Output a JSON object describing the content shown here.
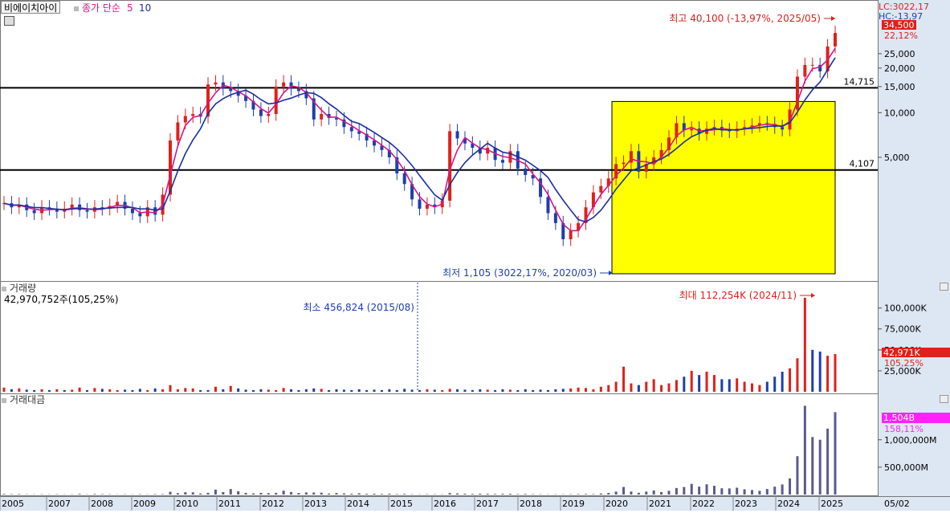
{
  "chart_data": [
    {
      "type": "candlestick",
      "title": "비에이치아이",
      "legend": [
        {
          "label": "종가 단순",
          "color": "#d4168a"
        },
        {
          "label": "5",
          "color": "#d4168a"
        },
        {
          "label": "10",
          "color": "#1a2ea0"
        }
      ],
      "y_scale": "log",
      "y_ticks": [
        5000,
        10000,
        15000,
        20000,
        25000
      ],
      "y_tick_labels": [
        "5,000",
        "10,000",
        "15,000",
        "20,000",
        "25,000"
      ],
      "hlines": [
        {
          "value": 14715,
          "label": "14,715"
        },
        {
          "value": 4107,
          "label": "4,107"
        }
      ],
      "highlight_box": {
        "x_start": "2020-01",
        "x_end": "2025-03",
        "y_low": 1105,
        "y_high": 11900,
        "color": "#ffff00"
      },
      "annotations": {
        "max": {
          "text": "최고 40,100 (-13,97%, 2025/05)",
          "value": 40100,
          "date": "2025-05"
        },
        "min": {
          "text": "최저 1,105 (3022,17%, 2020/03)",
          "value": 1105,
          "date": "2020-03"
        }
      },
      "right_labels": {
        "lc": "LC:3022,17",
        "hc": "HC:-13,97",
        "price": "34,500",
        "change": "22,12%"
      },
      "close_values": [
        2450,
        2300,
        2400,
        2200,
        2100,
        2300,
        2250,
        2150,
        2250,
        2400,
        2200,
        2150,
        2300,
        2250,
        2350,
        2500,
        2250,
        2100,
        2000,
        2300,
        2050,
        2800,
        6500,
        8600,
        9500,
        9800,
        9400,
        15500,
        16000,
        14500,
        14000,
        13000,
        12000,
        10500,
        9500,
        9800,
        15000,
        16000,
        14500,
        14000,
        12500,
        9000,
        9800,
        9200,
        9000,
        8000,
        7500,
        7200,
        6500,
        6000,
        5600,
        5000,
        3900,
        3300,
        2600,
        2250,
        2400,
        2300,
        2550,
        7500,
        6700,
        6200,
        5800,
        5300,
        5800,
        4800,
        4600,
        5500,
        4200,
        3800,
        3600,
        2700,
        2100,
        1800,
        1400,
        1600,
        1800,
        2300,
        2900,
        3200,
        3600,
        4500,
        4600,
        5500,
        4000,
        4500,
        5000,
        5600,
        6800,
        8500,
        7600,
        7800,
        7200,
        7800,
        8000,
        7600,
        7500,
        7800,
        8000,
        8200,
        8500,
        8400,
        8000,
        7700,
        10500,
        17500,
        21000,
        21000,
        19000,
        28000,
        34500
      ],
      "ma5": [],
      "ma10": []
    },
    {
      "type": "bar",
      "title": "거래량",
      "subtitle": "42,970,752주(105,25%)",
      "y_ticks": [
        25000,
        50000,
        75000,
        100000
      ],
      "y_tick_labels": [
        "25,000K",
        "50,000K",
        "75,000K",
        "100,000K"
      ],
      "annotations": {
        "max": {
          "text": "최대 112,254K (2024/11)",
          "value": 112254
        },
        "min": {
          "text": "최소 456,824 (2015/08)",
          "value": 456.824
        }
      },
      "right_labels": {
        "value": "42,971K",
        "change": "105,25%"
      },
      "values_k": [
        5000,
        3000,
        4000,
        2500,
        2000,
        3000,
        2000,
        3000,
        2000,
        2500,
        5000,
        2000,
        4500,
        3500,
        3000,
        2000,
        2500,
        2000,
        3500,
        2000,
        4000,
        3000,
        8000,
        3000,
        4500,
        4000,
        2000,
        2000,
        6000,
        3000,
        7000,
        4000,
        2500,
        2000,
        3000,
        2500,
        2000,
        4500,
        3000,
        2000,
        3000,
        4000,
        3500,
        2000,
        3000,
        2500,
        2000,
        3000,
        2000,
        2500,
        2000,
        3000,
        2000,
        3500,
        2500,
        2000,
        3000,
        2500,
        2000,
        3500,
        3000,
        2500,
        2000,
        3000,
        2500,
        2000,
        3000,
        2500,
        2000,
        3000,
        2000,
        2500,
        2000,
        3000,
        3500,
        4000,
        5000,
        4500,
        3000,
        6000,
        8000,
        12000,
        30000,
        10000,
        8000,
        12000,
        15000,
        8000,
        10000,
        14000,
        18000,
        25000,
        20000,
        24000,
        20000,
        15000,
        15000,
        16000,
        12000,
        10000,
        8000,
        12000,
        18000,
        24000,
        28000,
        40000,
        112254,
        50000,
        48000,
        42971,
        45000
      ],
      "colors": [
        "up",
        "down",
        "up",
        "down",
        "down",
        "up",
        "down",
        "up",
        "down",
        "up",
        "up",
        "down",
        "up",
        "down",
        "up",
        "up",
        "down",
        "down",
        "down",
        "up",
        "down",
        "up",
        "up",
        "up",
        "up",
        "up",
        "down",
        "down",
        "up",
        "down",
        "up",
        "down",
        "down",
        "down",
        "down",
        "up",
        "up",
        "up",
        "down",
        "down",
        "down",
        "down",
        "up",
        "down",
        "down",
        "down",
        "down",
        "down",
        "down",
        "down",
        "down",
        "down",
        "down",
        "down",
        "down",
        "down",
        "up",
        "down",
        "up",
        "up",
        "down",
        "down",
        "down",
        "down",
        "up",
        "down",
        "down",
        "up",
        "down",
        "down",
        "down",
        "down",
        "down",
        "down",
        "down",
        "up",
        "up",
        "up",
        "up",
        "up",
        "up",
        "up",
        "up",
        "up",
        "down",
        "up",
        "up",
        "up",
        "up",
        "up",
        "down",
        "up",
        "down",
        "up",
        "up",
        "down",
        "down",
        "up",
        "up",
        "up",
        "up",
        "down",
        "down",
        "down",
        "up",
        "up",
        "up",
        "down",
        "down",
        "up",
        "up"
      ]
    },
    {
      "type": "bar",
      "title": "거래대금",
      "y_ticks": [
        500000,
        1000000
      ],
      "y_tick_labels": [
        "500,000M",
        "1,000,000M"
      ],
      "right_labels": {
        "value": "1,504B",
        "change": "158,11%"
      },
      "values_m": [
        12000,
        7000,
        9000,
        5000,
        4000,
        6000,
        4000,
        6000,
        4000,
        5000,
        12000,
        4000,
        10000,
        8000,
        6000,
        4000,
        5000,
        4000,
        7000,
        4000,
        8000,
        8000,
        50000,
        25000,
        42000,
        40000,
        19000,
        31000,
        90000,
        45000,
        100000,
        60000,
        30000,
        21000,
        30000,
        25000,
        30000,
        70000,
        44000,
        28000,
        38000,
        36000,
        34000,
        18000,
        27000,
        20000,
        15000,
        22000,
        13000,
        15000,
        11000,
        15000,
        8000,
        12000,
        6500,
        4500,
        7000,
        6000,
        5000,
        26000,
        20000,
        15000,
        12000,
        16000,
        14000,
        10000,
        14000,
        14000,
        8500,
        11000,
        7000,
        6000,
        4200,
        5400,
        4900,
        6400,
        9000,
        10000,
        8700,
        19000,
        29000,
        54000,
        138000,
        55000,
        32000,
        54000,
        75000,
        45000,
        68000,
        119000,
        137000,
        195000,
        144000,
        187000,
        160000,
        114000,
        112000,
        125000,
        96000,
        82000,
        68000,
        101000,
        144000,
        185000,
        294000,
        700000,
        1620000,
        1050000,
        1000000,
        1203000,
        1504000
      ]
    },
    {
      "type": "axis",
      "x_tick_labels": [
        "2005",
        "2007",
        "2008",
        "2009",
        "2010",
        "2011",
        "2012",
        "2013",
        "2014",
        "2015",
        "2016",
        "2017",
        "2018",
        "2019",
        "2020",
        "2021",
        "2022",
        "2023",
        "2024",
        "2025"
      ],
      "x_end_label": "05/02"
    }
  ]
}
